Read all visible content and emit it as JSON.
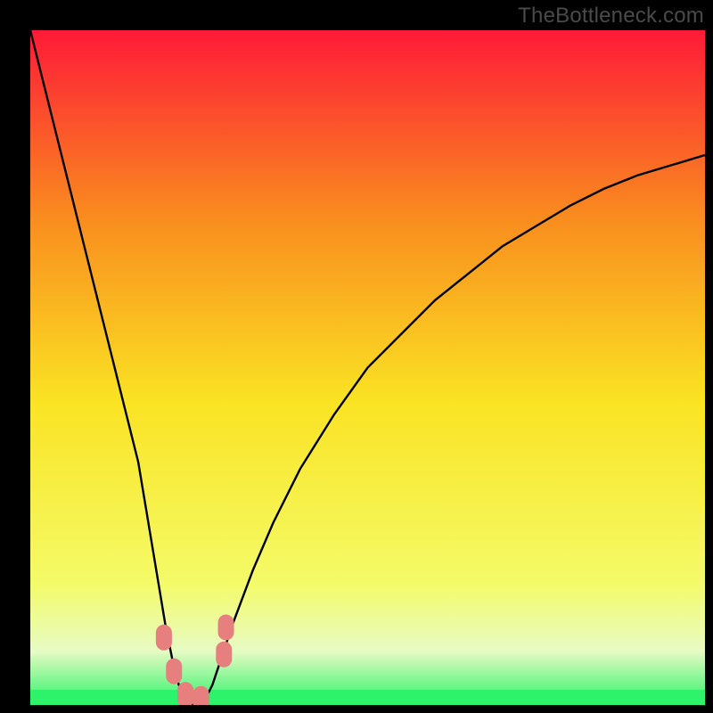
{
  "watermark": "TheBottleneck.com",
  "colors": {
    "gradient_top": "#fe1a38",
    "gradient_q1": "#f98d1e",
    "gradient_mid": "#fae323",
    "gradient_q3": "#f4fb68",
    "gradient_band": "#e7fbc4",
    "gradient_bottom": "#2cf36a",
    "curve": "#000000",
    "marker": "#e67f7d",
    "frame": "#000000"
  },
  "chart_data": {
    "type": "line",
    "title": "",
    "xlabel": "",
    "ylabel": "",
    "xlim": [
      0,
      100
    ],
    "ylim": [
      0,
      100
    ],
    "series": [
      {
        "name": "bottleneck-curve",
        "x": [
          0,
          2,
          4,
          6,
          8,
          10,
          12,
          14,
          16,
          18,
          19,
          20,
          21,
          22,
          23,
          24,
          25,
          26,
          27,
          28,
          30,
          33,
          36,
          40,
          45,
          50,
          55,
          60,
          65,
          70,
          75,
          80,
          85,
          90,
          95,
          100
        ],
        "y": [
          100,
          92,
          84,
          76,
          68,
          60,
          52,
          44,
          36,
          24,
          18,
          12,
          7,
          3,
          1,
          0,
          0,
          1,
          3,
          6,
          12,
          20,
          27,
          35,
          43,
          50,
          55,
          60,
          64,
          68,
          71,
          74,
          76.5,
          78.5,
          80,
          81.5
        ]
      }
    ],
    "markers": {
      "name": "highlight-points",
      "points": [
        {
          "x": 19.8,
          "y": 10.0
        },
        {
          "x": 21.3,
          "y": 5.0
        },
        {
          "x": 23.0,
          "y": 1.5
        },
        {
          "x": 25.3,
          "y": 0.9
        },
        {
          "x": 28.7,
          "y": 7.5
        },
        {
          "x": 29.0,
          "y": 11.5
        }
      ]
    },
    "min_x": 24.5
  }
}
